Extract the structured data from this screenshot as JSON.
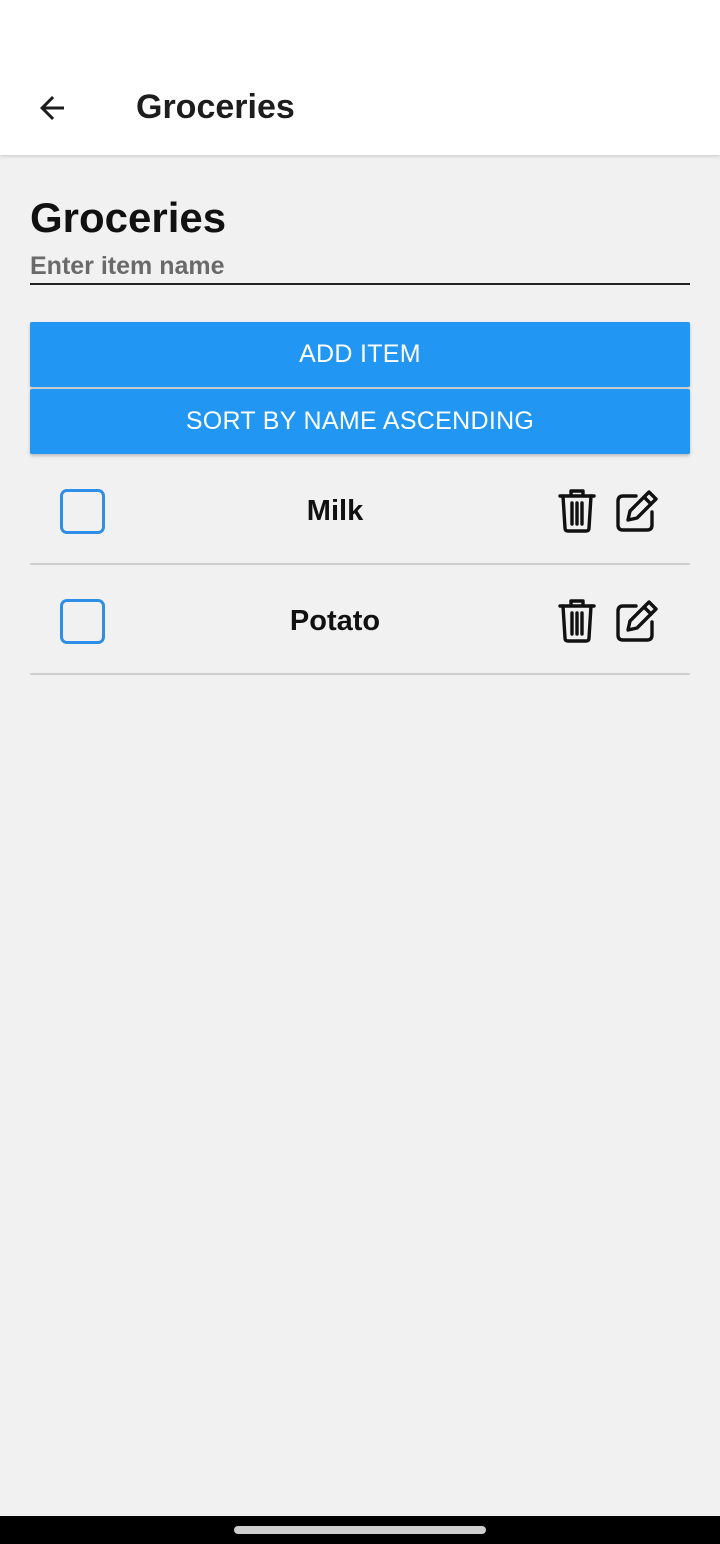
{
  "app_bar": {
    "title": "Groceries",
    "back_icon": "arrow-left-icon"
  },
  "main": {
    "heading": "Groceries",
    "input": {
      "placeholder": "Enter item name",
      "value": ""
    },
    "add_button_label": "ADD ITEM",
    "sort_button_label": "SORT BY NAME ASCENDING"
  },
  "items": [
    {
      "name": "Milk",
      "checked": false,
      "delete_icon": "trash-icon",
      "edit_icon": "edit-icon"
    },
    {
      "name": "Potato",
      "checked": false,
      "delete_icon": "trash-icon",
      "edit_icon": "edit-icon"
    }
  ],
  "colors": {
    "accent": "#2196f3",
    "checkbox_border": "#2f8fe8",
    "background": "#f1f1f1",
    "app_bar": "#ffffff"
  }
}
